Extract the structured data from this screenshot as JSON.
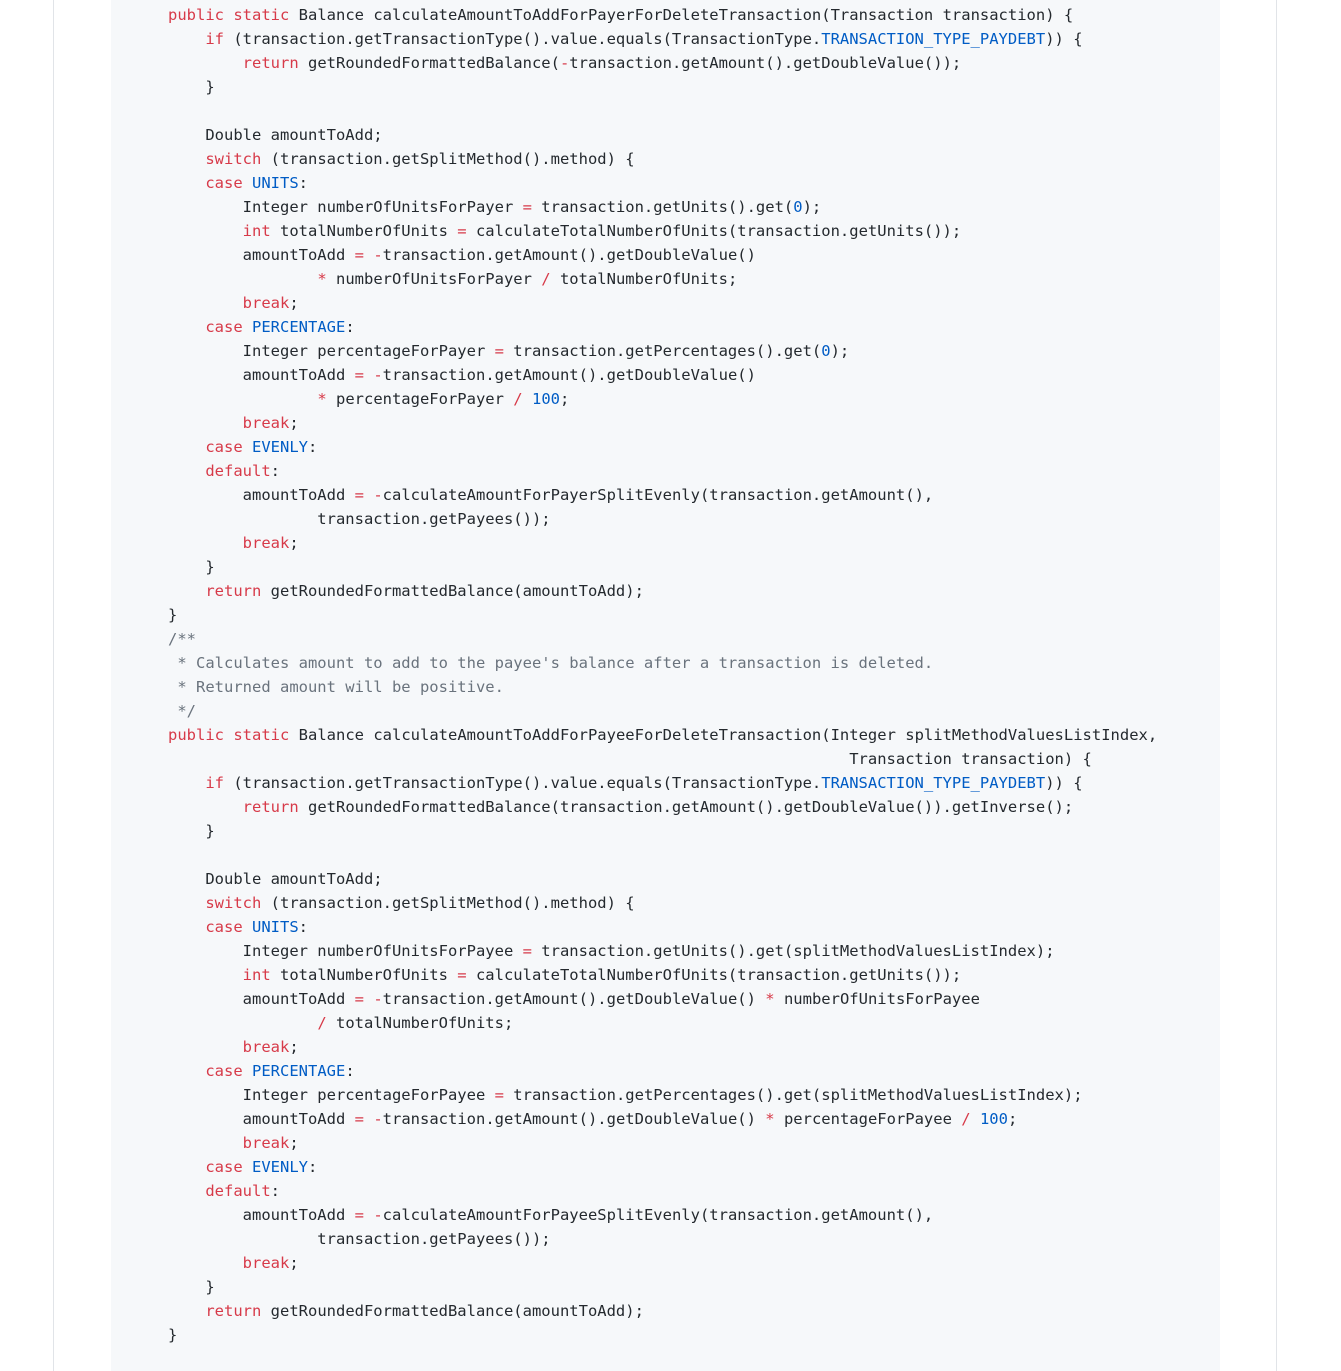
{
  "code": {
    "language": "java",
    "lines": [
      [
        [
          "kw",
          "public"
        ],
        [
          "pl",
          " "
        ],
        [
          "kw",
          "static"
        ],
        [
          "pl",
          " Balance calculateAmountToAddForPayerForDeleteTransaction(Transaction transaction) {"
        ]
      ],
      [
        [
          "pl",
          "    "
        ],
        [
          "kw",
          "if"
        ],
        [
          "pl",
          " (transaction.getTransactionType().value.equals(TransactionType."
        ],
        [
          "const",
          "TRANSACTION_TYPE_PAYDEBT"
        ],
        [
          "pl",
          ")) {"
        ]
      ],
      [
        [
          "pl",
          "        "
        ],
        [
          "kw",
          "return"
        ],
        [
          "pl",
          " getRoundedFormattedBalance("
        ],
        [
          "op",
          "-"
        ],
        [
          "pl",
          "transaction.getAmount().getDoubleValue());"
        ]
      ],
      [
        [
          "pl",
          "    }"
        ]
      ],
      [
        [
          "pl",
          ""
        ]
      ],
      [
        [
          "pl",
          "    Double amountToAdd;"
        ]
      ],
      [
        [
          "pl",
          "    "
        ],
        [
          "kw",
          "switch"
        ],
        [
          "pl",
          " (transaction.getSplitMethod().method) {"
        ]
      ],
      [
        [
          "pl",
          "    "
        ],
        [
          "kw",
          "case"
        ],
        [
          "pl",
          " "
        ],
        [
          "const",
          "UNITS"
        ],
        [
          "pl",
          ":"
        ]
      ],
      [
        [
          "pl",
          "        Integer numberOfUnitsForPayer "
        ],
        [
          "op",
          "="
        ],
        [
          "pl",
          " transaction.getUnits().get("
        ],
        [
          "num",
          "0"
        ],
        [
          "pl",
          ");"
        ]
      ],
      [
        [
          "pl",
          "        "
        ],
        [
          "kw",
          "int"
        ],
        [
          "pl",
          " totalNumberOfUnits "
        ],
        [
          "op",
          "="
        ],
        [
          "pl",
          " calculateTotalNumberOfUnits(transaction.getUnits());"
        ]
      ],
      [
        [
          "pl",
          "        amountToAdd "
        ],
        [
          "op",
          "="
        ],
        [
          "pl",
          " "
        ],
        [
          "op",
          "-"
        ],
        [
          "pl",
          "transaction.getAmount().getDoubleValue()"
        ]
      ],
      [
        [
          "pl",
          "                "
        ],
        [
          "op",
          "*"
        ],
        [
          "pl",
          " numberOfUnitsForPayer "
        ],
        [
          "op",
          "/"
        ],
        [
          "pl",
          " totalNumberOfUnits;"
        ]
      ],
      [
        [
          "pl",
          "        "
        ],
        [
          "kw",
          "break"
        ],
        [
          "pl",
          ";"
        ]
      ],
      [
        [
          "pl",
          "    "
        ],
        [
          "kw",
          "case"
        ],
        [
          "pl",
          " "
        ],
        [
          "const",
          "PERCENTAGE"
        ],
        [
          "pl",
          ":"
        ]
      ],
      [
        [
          "pl",
          "        Integer percentageForPayer "
        ],
        [
          "op",
          "="
        ],
        [
          "pl",
          " transaction.getPercentages().get("
        ],
        [
          "num",
          "0"
        ],
        [
          "pl",
          ");"
        ]
      ],
      [
        [
          "pl",
          "        amountToAdd "
        ],
        [
          "op",
          "="
        ],
        [
          "pl",
          " "
        ],
        [
          "op",
          "-"
        ],
        [
          "pl",
          "transaction.getAmount().getDoubleValue()"
        ]
      ],
      [
        [
          "pl",
          "                "
        ],
        [
          "op",
          "*"
        ],
        [
          "pl",
          " percentageForPayer "
        ],
        [
          "op",
          "/"
        ],
        [
          "pl",
          " "
        ],
        [
          "num",
          "100"
        ],
        [
          "pl",
          ";"
        ]
      ],
      [
        [
          "pl",
          "        "
        ],
        [
          "kw",
          "break"
        ],
        [
          "pl",
          ";"
        ]
      ],
      [
        [
          "pl",
          "    "
        ],
        [
          "kw",
          "case"
        ],
        [
          "pl",
          " "
        ],
        [
          "const",
          "EVENLY"
        ],
        [
          "pl",
          ":"
        ]
      ],
      [
        [
          "pl",
          "    "
        ],
        [
          "kw",
          "default"
        ],
        [
          "pl",
          ":"
        ]
      ],
      [
        [
          "pl",
          "        amountToAdd "
        ],
        [
          "op",
          "="
        ],
        [
          "pl",
          " "
        ],
        [
          "op",
          "-"
        ],
        [
          "pl",
          "calculateAmountForPayerSplitEvenly(transaction.getAmount(),"
        ]
      ],
      [
        [
          "pl",
          "                transaction.getPayees());"
        ]
      ],
      [
        [
          "pl",
          "        "
        ],
        [
          "kw",
          "break"
        ],
        [
          "pl",
          ";"
        ]
      ],
      [
        [
          "pl",
          "    }"
        ]
      ],
      [
        [
          "pl",
          "    "
        ],
        [
          "kw",
          "return"
        ],
        [
          "pl",
          " getRoundedFormattedBalance(amountToAdd);"
        ]
      ],
      [
        [
          "pl",
          "}"
        ]
      ],
      [
        [
          "cm",
          "/**"
        ]
      ],
      [
        [
          "cm",
          " * Calculates amount to add to the payee's balance after a transaction is deleted."
        ]
      ],
      [
        [
          "cm",
          " * Returned amount will be positive."
        ]
      ],
      [
        [
          "cm",
          " */"
        ]
      ],
      [
        [
          "kw",
          "public"
        ],
        [
          "pl",
          " "
        ],
        [
          "kw",
          "static"
        ],
        [
          "pl",
          " Balance calculateAmountToAddForPayeeForDeleteTransaction(Integer splitMethodValuesListIndex,"
        ]
      ],
      [
        [
          "pl",
          "                                                                         Transaction transaction) {"
        ]
      ],
      [
        [
          "pl",
          "    "
        ],
        [
          "kw",
          "if"
        ],
        [
          "pl",
          " (transaction.getTransactionType().value.equals(TransactionType."
        ],
        [
          "const",
          "TRANSACTION_TYPE_PAYDEBT"
        ],
        [
          "pl",
          ")) {"
        ]
      ],
      [
        [
          "pl",
          "        "
        ],
        [
          "kw",
          "return"
        ],
        [
          "pl",
          " getRoundedFormattedBalance(transaction.getAmount().getDoubleValue()).getInverse();"
        ]
      ],
      [
        [
          "pl",
          "    }"
        ]
      ],
      [
        [
          "pl",
          ""
        ]
      ],
      [
        [
          "pl",
          "    Double amountToAdd;"
        ]
      ],
      [
        [
          "pl",
          "    "
        ],
        [
          "kw",
          "switch"
        ],
        [
          "pl",
          " (transaction.getSplitMethod().method) {"
        ]
      ],
      [
        [
          "pl",
          "    "
        ],
        [
          "kw",
          "case"
        ],
        [
          "pl",
          " "
        ],
        [
          "const",
          "UNITS"
        ],
        [
          "pl",
          ":"
        ]
      ],
      [
        [
          "pl",
          "        Integer numberOfUnitsForPayee "
        ],
        [
          "op",
          "="
        ],
        [
          "pl",
          " transaction.getUnits().get(splitMethodValuesListIndex);"
        ]
      ],
      [
        [
          "pl",
          "        "
        ],
        [
          "kw",
          "int"
        ],
        [
          "pl",
          " totalNumberOfUnits "
        ],
        [
          "op",
          "="
        ],
        [
          "pl",
          " calculateTotalNumberOfUnits(transaction.getUnits());"
        ]
      ],
      [
        [
          "pl",
          "        amountToAdd "
        ],
        [
          "op",
          "="
        ],
        [
          "pl",
          " "
        ],
        [
          "op",
          "-"
        ],
        [
          "pl",
          "transaction.getAmount().getDoubleValue() "
        ],
        [
          "op",
          "*"
        ],
        [
          "pl",
          " numberOfUnitsForPayee"
        ]
      ],
      [
        [
          "pl",
          "                "
        ],
        [
          "op",
          "/"
        ],
        [
          "pl",
          " totalNumberOfUnits;"
        ]
      ],
      [
        [
          "pl",
          "        "
        ],
        [
          "kw",
          "break"
        ],
        [
          "pl",
          ";"
        ]
      ],
      [
        [
          "pl",
          "    "
        ],
        [
          "kw",
          "case"
        ],
        [
          "pl",
          " "
        ],
        [
          "const",
          "PERCENTAGE"
        ],
        [
          "pl",
          ":"
        ]
      ],
      [
        [
          "pl",
          "        Integer percentageForPayee "
        ],
        [
          "op",
          "="
        ],
        [
          "pl",
          " transaction.getPercentages().get(splitMethodValuesListIndex);"
        ]
      ],
      [
        [
          "pl",
          "        amountToAdd "
        ],
        [
          "op",
          "="
        ],
        [
          "pl",
          " "
        ],
        [
          "op",
          "-"
        ],
        [
          "pl",
          "transaction.getAmount().getDoubleValue() "
        ],
        [
          "op",
          "*"
        ],
        [
          "pl",
          " percentageForPayee "
        ],
        [
          "op",
          "/"
        ],
        [
          "pl",
          " "
        ],
        [
          "num",
          "100"
        ],
        [
          "pl",
          ";"
        ]
      ],
      [
        [
          "pl",
          "        "
        ],
        [
          "kw",
          "break"
        ],
        [
          "pl",
          ";"
        ]
      ],
      [
        [
          "pl",
          "    "
        ],
        [
          "kw",
          "case"
        ],
        [
          "pl",
          " "
        ],
        [
          "const",
          "EVENLY"
        ],
        [
          "pl",
          ":"
        ]
      ],
      [
        [
          "pl",
          "    "
        ],
        [
          "kw",
          "default"
        ],
        [
          "pl",
          ":"
        ]
      ],
      [
        [
          "pl",
          "        amountToAdd "
        ],
        [
          "op",
          "="
        ],
        [
          "pl",
          " "
        ],
        [
          "op",
          "-"
        ],
        [
          "pl",
          "calculateAmountForPayeeSplitEvenly(transaction.getAmount(),"
        ]
      ],
      [
        [
          "pl",
          "                transaction.getPayees());"
        ]
      ],
      [
        [
          "pl",
          "        "
        ],
        [
          "kw",
          "break"
        ],
        [
          "pl",
          ";"
        ]
      ],
      [
        [
          "pl",
          "    }"
        ]
      ],
      [
        [
          "pl",
          "    "
        ],
        [
          "kw",
          "return"
        ],
        [
          "pl",
          " getRoundedFormattedBalance(amountToAdd);"
        ]
      ],
      [
        [
          "pl",
          "}"
        ]
      ]
    ]
  },
  "colors": {
    "keyword": "#d73a49",
    "constant": "#005cc5",
    "comment": "#6a737d",
    "text": "#24292e",
    "code_background": "#f6f8fa"
  }
}
